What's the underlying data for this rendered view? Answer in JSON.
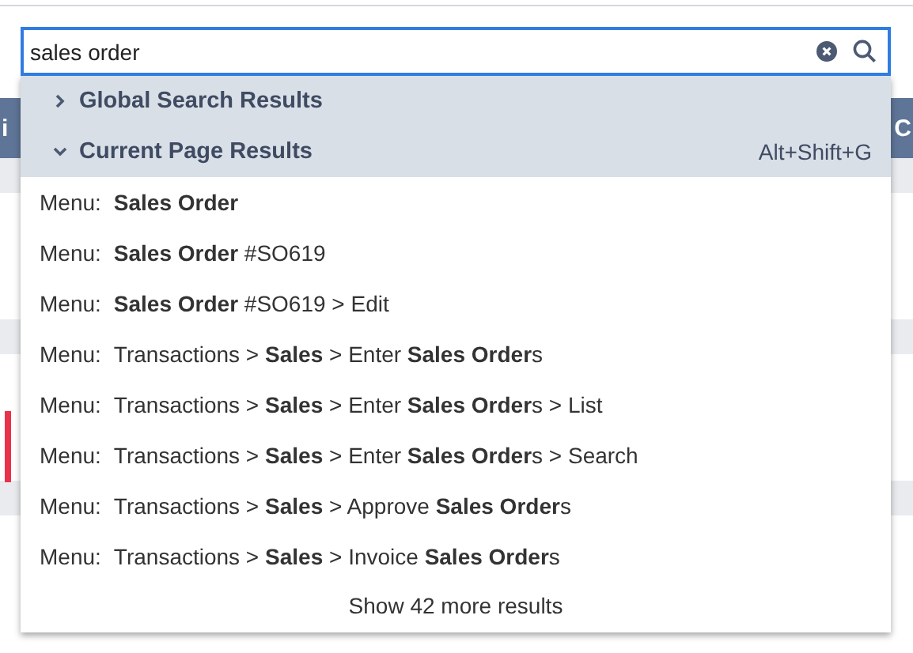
{
  "background": {
    "header_left": "i",
    "header_right": "C"
  },
  "search": {
    "value": "sales order"
  },
  "sections": [
    {
      "label": "Global Search Results",
      "expanded": false
    },
    {
      "label": "Current Page Results",
      "expanded": true,
      "shortcut": "Alt+Shift+G"
    }
  ],
  "results": [
    {
      "prefix": "Menu:",
      "text": "**Sales Order**"
    },
    {
      "prefix": "Menu:",
      "text": "**Sales Order** #SO619"
    },
    {
      "prefix": "Menu:",
      "text": "**Sales Order** #SO619 > Edit"
    },
    {
      "prefix": "Menu:",
      "text": "Transactions > **Sales** > Enter **Sales Order**s"
    },
    {
      "prefix": "Menu:",
      "text": "Transactions > **Sales** > Enter **Sales Order**s > List"
    },
    {
      "prefix": "Menu:",
      "text": "Transactions > **Sales** > Enter **Sales Order**s > Search"
    },
    {
      "prefix": "Menu:",
      "text": "Transactions > **Sales** > Approve **Sales Order**s"
    },
    {
      "prefix": "Menu:",
      "text": "Transactions > **Sales** > Invoice **Sales Order**s"
    }
  ],
  "more": "Show 42 more results"
}
